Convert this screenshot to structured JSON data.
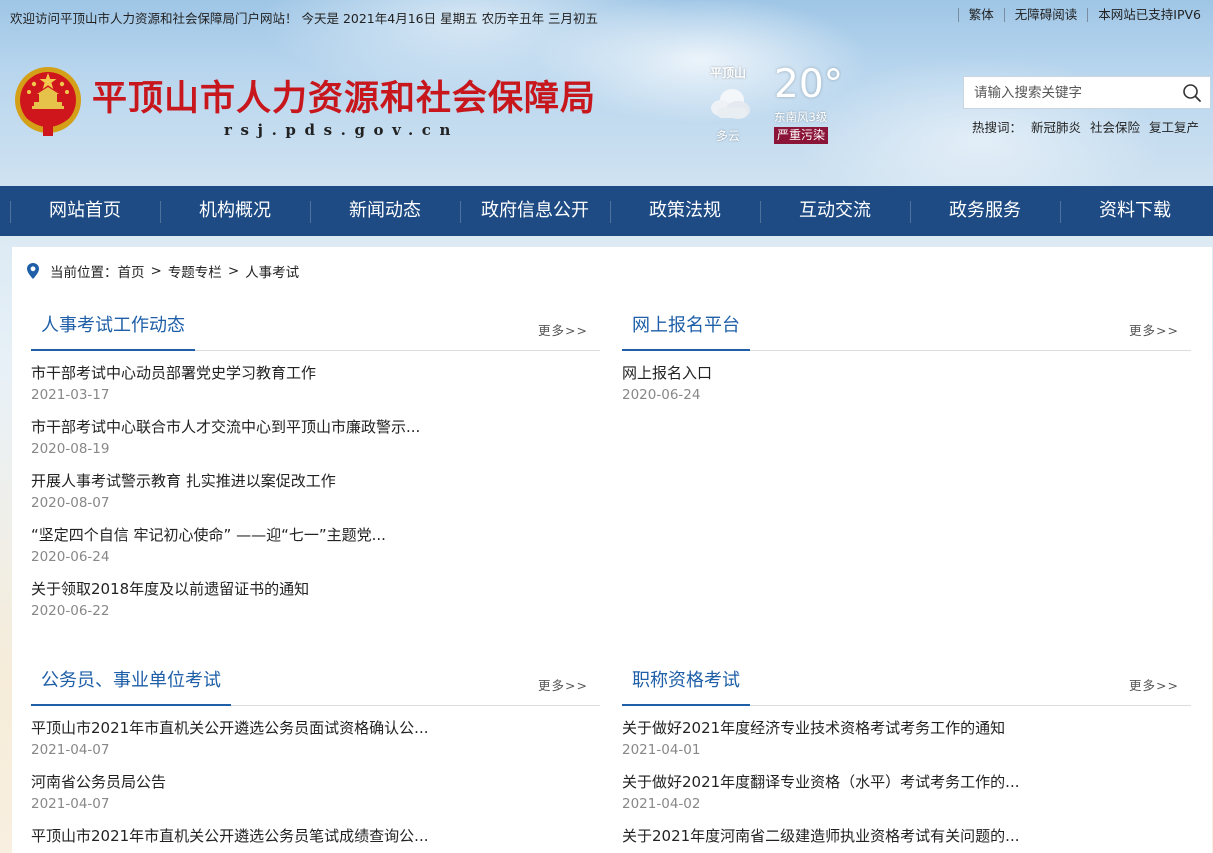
{
  "topbar": {
    "welcome": "欢迎访问平顶山市人力资源和社会保障局门户网站！ 今天是 2021年4月16日 星期五 农历辛丑年 三月初五",
    "links": [
      "繁体",
      "无障碍阅读",
      "本网站已支持IPV6"
    ]
  },
  "header": {
    "title": "平顶山市人力资源和社会保障局",
    "domain": "rsj.pds.gov.cn"
  },
  "weather": {
    "city": "平顶山",
    "condition": "多云",
    "temperature": "20°",
    "wind": "东南风3级",
    "air_quality": "严重污染",
    "icon": "cloud-icon"
  },
  "search": {
    "placeholder": "请输入搜索关键字",
    "hot_label": "热搜词：",
    "hot_words": [
      "新冠肺炎",
      "社会保险",
      "复工复产"
    ]
  },
  "nav": [
    "网站首页",
    "机构概况",
    "新闻动态",
    "政府信息公开",
    "政策法规",
    "互动交流",
    "政务服务",
    "资料下载"
  ],
  "breadcrumb": {
    "label": "当前位置：",
    "items": [
      "首页",
      "专题专栏",
      "人事考试"
    ],
    "separator": ">"
  },
  "sections": [
    {
      "title": "人事考试工作动态",
      "more": "更多>>",
      "items": [
        {
          "title": "市干部考试中心动员部署党史学习教育工作",
          "date": "2021-03-17"
        },
        {
          "title": "市干部考试中心联合市人才交流中心到平顶山市廉政警示...",
          "date": "2020-08-19"
        },
        {
          "title": "开展人事考试警示教育 扎实推进以案促改工作",
          "date": "2020-08-07"
        },
        {
          "title": "“坚定四个自信 牢记初心使命” ——迎“七一”主题党...",
          "date": "2020-06-24"
        },
        {
          "title": "关于领取2018年度及以前遗留证书的通知",
          "date": "2020-06-22"
        }
      ]
    },
    {
      "title": "网上报名平台",
      "more": "更多>>",
      "items": [
        {
          "title": "网上报名入口",
          "date": "2020-06-24"
        }
      ]
    },
    {
      "title": "公务员、事业单位考试",
      "more": "更多>>",
      "items": [
        {
          "title": "平顶山市2021年市直机关公开遴选公务员面试资格确认公...",
          "date": "2021-04-07"
        },
        {
          "title": "河南省公务员局公告",
          "date": "2021-04-07"
        },
        {
          "title": "平顶山市2021年市直机关公开遴选公务员笔试成绩查询公...",
          "date": ""
        }
      ]
    },
    {
      "title": "职称资格考试",
      "more": "更多>>",
      "items": [
        {
          "title": "关于做好2021年度经济专业技术资格考试考务工作的通知",
          "date": "2021-04-01"
        },
        {
          "title": "关于做好2021年度翻译专业资格（水平）考试考务工作的...",
          "date": "2021-04-02"
        },
        {
          "title": "关于2021年度河南省二级建造师执业资格考试有关问题的...",
          "date": ""
        }
      ]
    }
  ],
  "colors": {
    "nav_bg": "#1e4b84",
    "title_red": "#c8161d",
    "section_blue": "#1e5fa8",
    "aqi_bg": "#8a1538"
  }
}
